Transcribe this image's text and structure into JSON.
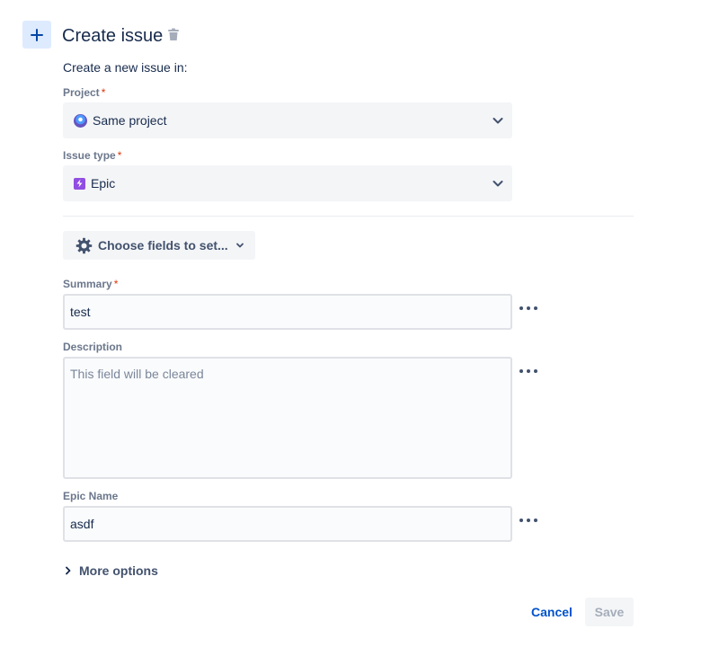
{
  "header": {
    "add_icon": "plus-icon",
    "title": "Create issue",
    "delete_icon": "trash-icon"
  },
  "intro": "Create a new issue in:",
  "project": {
    "label": "Project",
    "required_mark": "*",
    "value": "Same project",
    "icon": "project-avatar-icon"
  },
  "issue_type": {
    "label": "Issue type",
    "required_mark": "*",
    "value": "Epic",
    "icon": "epic-icon"
  },
  "choose_fields": {
    "label": "Choose fields to set...",
    "icon": "gear-icon"
  },
  "summary": {
    "label": "Summary",
    "required_mark": "*",
    "value": "test"
  },
  "description": {
    "label": "Description",
    "placeholder": "This field will be cleared"
  },
  "epic_name": {
    "label": "Epic Name",
    "value": "asdf"
  },
  "more_options": "More options",
  "actions": {
    "cancel": "Cancel",
    "save": "Save"
  },
  "colors": {
    "accent": "#0052cc",
    "required": "#de350b",
    "epic": "#904ee2"
  }
}
